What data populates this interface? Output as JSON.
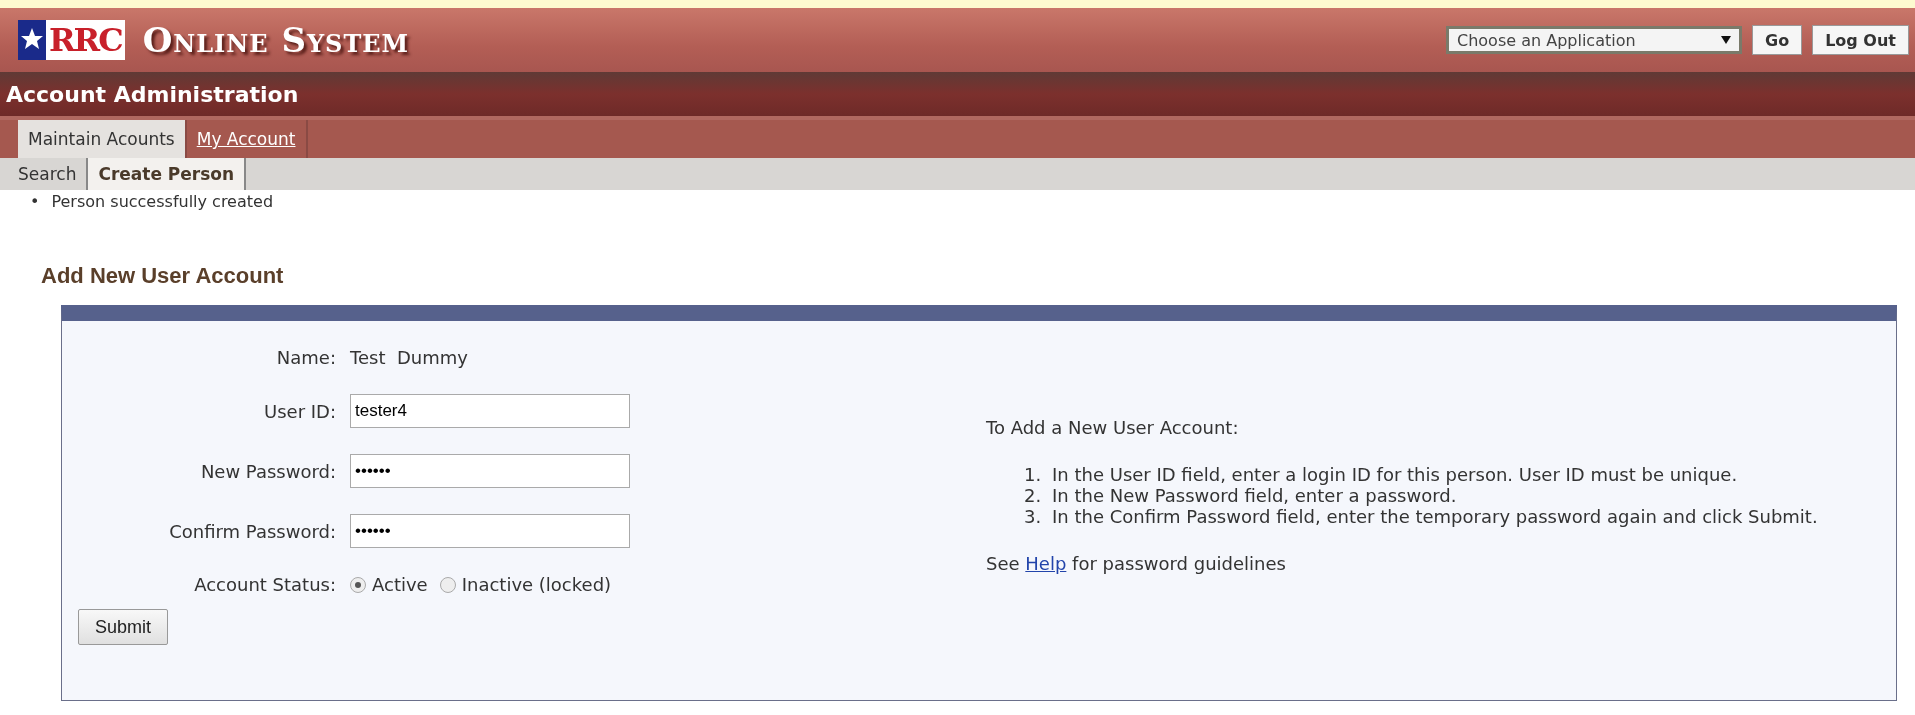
{
  "header": {
    "logo_text": "RRC",
    "title": "Online System",
    "app_select": {
      "value": "Choose an Application"
    },
    "buttons": [
      "Go",
      "Log Out"
    ]
  },
  "section_title": "Account Administration",
  "tabs": [
    {
      "label": "Maintain Acounts",
      "selected": true
    },
    {
      "label": "My Account",
      "selected": false
    }
  ],
  "subtabs": [
    {
      "label": "Search",
      "selected": false
    },
    {
      "label": "Create Person",
      "selected": true
    }
  ],
  "messages": [
    {
      "bullet": "•",
      "text": "Person successfully created"
    }
  ],
  "form": {
    "title": "Add New User Account",
    "name_label": "Name:",
    "name_value": "Test  Dummy",
    "fields": [
      {
        "label": "User ID:",
        "value": "tester4"
      },
      {
        "label": "New Password:",
        "value": "••••••"
      },
      {
        "label": "Confirm Password:",
        "value": "••••••"
      }
    ],
    "status": {
      "label": "Account Status:",
      "options": [
        {
          "label": "Active",
          "selected": true
        },
        {
          "label": "Inactive (locked)",
          "selected": false
        }
      ]
    },
    "submit": "Submit"
  },
  "help": {
    "intro": "To Add a New User Account:",
    "steps": [
      {
        "number": "1.",
        "text": "In the User ID field, enter a login ID for this person. User ID must be unique."
      },
      {
        "number": "2.",
        "text": "In the New Password field, enter a password."
      },
      {
        "number": "3.",
        "text": "In the Confirm Password field, enter the temporary password again and click Submit."
      }
    ],
    "footer_before": "See",
    "link": "Help",
    "footer_after": "for password guidelines"
  }
}
